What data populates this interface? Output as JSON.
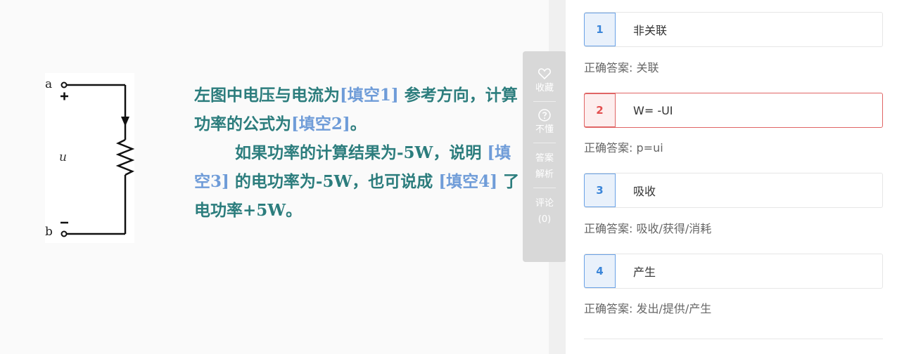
{
  "question": {
    "circuit": {
      "node_a": "a",
      "node_b": "b",
      "plus_sign": "+",
      "minus_sign": "−",
      "voltage_label": "u"
    },
    "line1_pre": "左图中电压与电流为",
    "blank1": "[填空1]",
    "line1_post": "参考方向，计算功率的公式为",
    "blank2": "[填空2]",
    "line2_post": "。",
    "line3_pre": "如果功率的计算结果为-5W，说明",
    "blank3": "[填空3]",
    "line3_post": "的电功率为-5W，也可说成",
    "blank4": "[填空4]",
    "line4_post": "了电功率+5W。"
  },
  "tools": {
    "favorite_label": "收藏",
    "dont_understand_label": "不懂",
    "answer_analysis_label_1": "答案",
    "answer_analysis_label_2": "解析",
    "comment_label": "评论",
    "comment_count": "(0)"
  },
  "answers": [
    {
      "num": "1",
      "value": "非关联",
      "correct_prefix": "正确答案:",
      "correct": "关联",
      "status": "normal"
    },
    {
      "num": "2",
      "value": "W= -UI",
      "correct_prefix": "正确答案:",
      "correct": "p=ui",
      "status": "wrong"
    },
    {
      "num": "3",
      "value": "吸收",
      "correct_prefix": "正确答案:",
      "correct": "吸收/获得/消耗",
      "status": "normal"
    },
    {
      "num": "4",
      "value": "产生",
      "correct_prefix": "正确答案:",
      "correct": "发出/提供/产生",
      "status": "normal"
    }
  ],
  "colors": {
    "question_text": "#2c7d7d",
    "blank_text": "#6f9cd8",
    "answer_num_blue": "#3c86d9",
    "answer_num_red": "#e35050",
    "tool_panel_bg": "#d8d8d8"
  }
}
